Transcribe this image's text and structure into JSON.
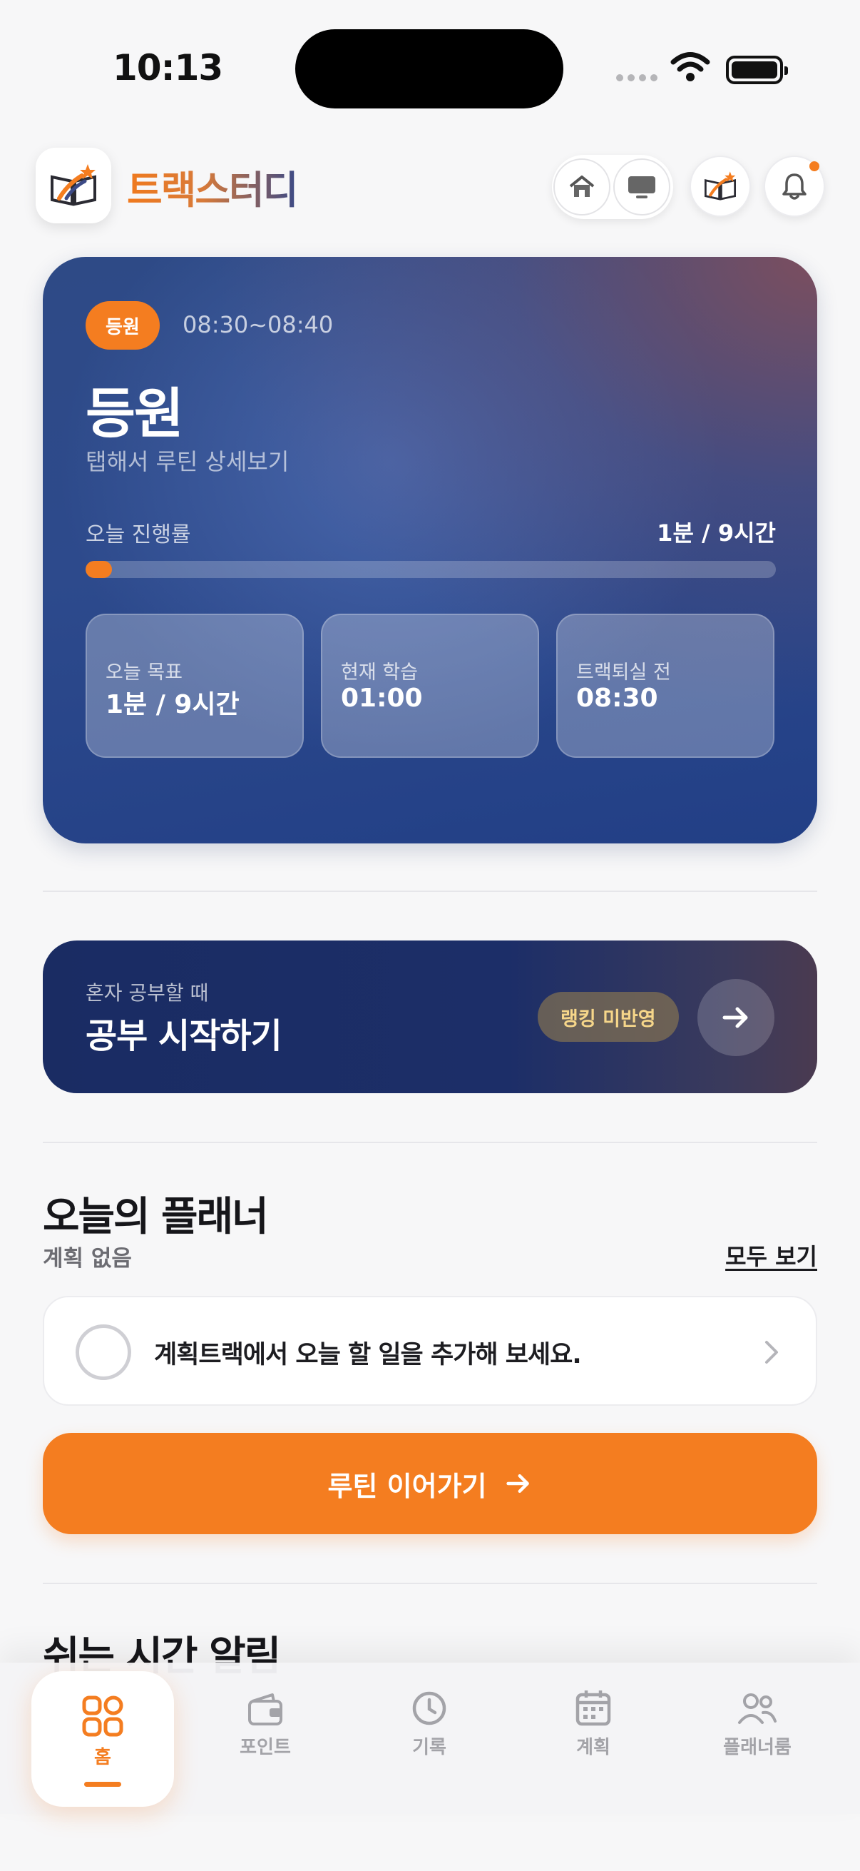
{
  "status_bar": {
    "time": "10:13"
  },
  "header": {
    "app_name": "트랙스터디",
    "buttons": [
      "home-icon",
      "monitor-icon",
      "app-logo-icon",
      "bell-icon"
    ]
  },
  "hero": {
    "badge": "등원",
    "time_range": "08:30~08:40",
    "title": "등원",
    "subtitle": "탭해서 루틴 상세보기",
    "progress_label": "오늘 진행률",
    "progress_value": "1분 / 9시간",
    "progress_fraction": 0.02,
    "stats": [
      {
        "label": "오늘 목표",
        "value": "1분 / 9시간"
      },
      {
        "label": "현재 학습",
        "value": "01:00"
      },
      {
        "label": "트랙퇴실 전",
        "value": "08:30"
      }
    ]
  },
  "study": {
    "subtitle": "혼자 공부할 때",
    "title": "공부 시작하기",
    "badge": "랭킹 미반영"
  },
  "planner": {
    "title": "오늘의 플래너",
    "subtitle": "계획 없음",
    "see_all": "모두 보기",
    "todo_text": "계획트랙에서 오늘 할 일을 추가해 보세요."
  },
  "cta": {
    "label": "루틴 이어가기"
  },
  "rest": {
    "title": "쉬는 시간 알림"
  },
  "tabbar": {
    "tabs": [
      {
        "label": "홈",
        "icon": "grid-icon",
        "active": true
      },
      {
        "label": "포인트",
        "icon": "wallet-icon"
      },
      {
        "label": "기록",
        "icon": "clock-icon"
      },
      {
        "label": "계획",
        "icon": "calendar-icon"
      },
      {
        "label": "플래너룸",
        "icon": "people-icon"
      }
    ]
  },
  "colors": {
    "accent": "#f47d20",
    "navy": "#1c2e68",
    "hero": "#2d4a8c"
  }
}
